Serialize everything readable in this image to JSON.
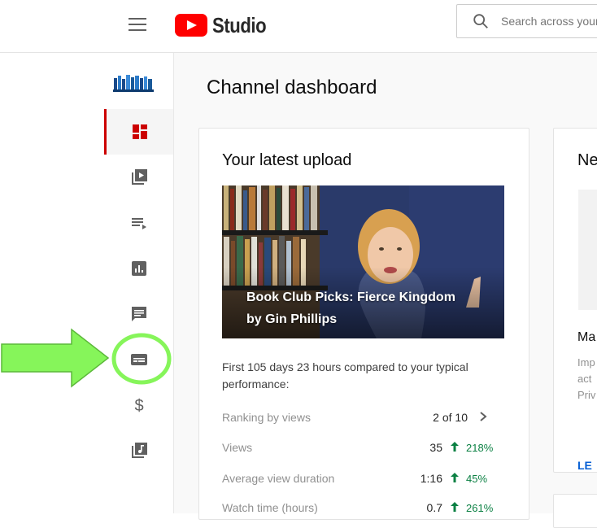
{
  "header": {
    "brand": "Studio",
    "search_placeholder": "Search across your channel"
  },
  "sidebar": {
    "items": [
      {
        "name": "Dashboard",
        "icon": "dashboard-icon",
        "active": true
      },
      {
        "name": "Content",
        "icon": "video-library-icon"
      },
      {
        "name": "Playlists",
        "icon": "playlist-icon"
      },
      {
        "name": "Analytics",
        "icon": "analytics-icon"
      },
      {
        "name": "Comments",
        "icon": "comments-icon"
      },
      {
        "name": "Subtitles",
        "icon": "subtitles-icon"
      },
      {
        "name": "Monetization",
        "icon": "dollar-icon"
      },
      {
        "name": "Audio library",
        "icon": "audio-library-icon"
      }
    ]
  },
  "main": {
    "page_title": "Channel dashboard",
    "latest_upload": {
      "title": "Your latest upload",
      "video_title_line1": "Book Club Picks: Fierce Kingdom",
      "video_title_line2": "by Gin Phillips",
      "performance_text": "First 105 days 23 hours compared to your typical performance:",
      "metrics": [
        {
          "label": "Ranking by views",
          "value": "2 of 10",
          "change": ""
        },
        {
          "label": "Views",
          "value": "35",
          "change": "218%"
        },
        {
          "label": "Average view duration",
          "value": "1:16",
          "change": "45%"
        },
        {
          "label": "Watch time (hours)",
          "value": "0.7",
          "change": "261%"
        }
      ]
    },
    "news_card": {
      "title": "Ne",
      "subtitle": "Ma",
      "body_lines": [
        "Imp",
        "act",
        "Priv"
      ],
      "link": "LE"
    }
  },
  "colors": {
    "accent": "#cc0000",
    "youtube_red": "#ff0000",
    "positive": "#0b8043",
    "annotation_green": "#7CFC5A"
  }
}
